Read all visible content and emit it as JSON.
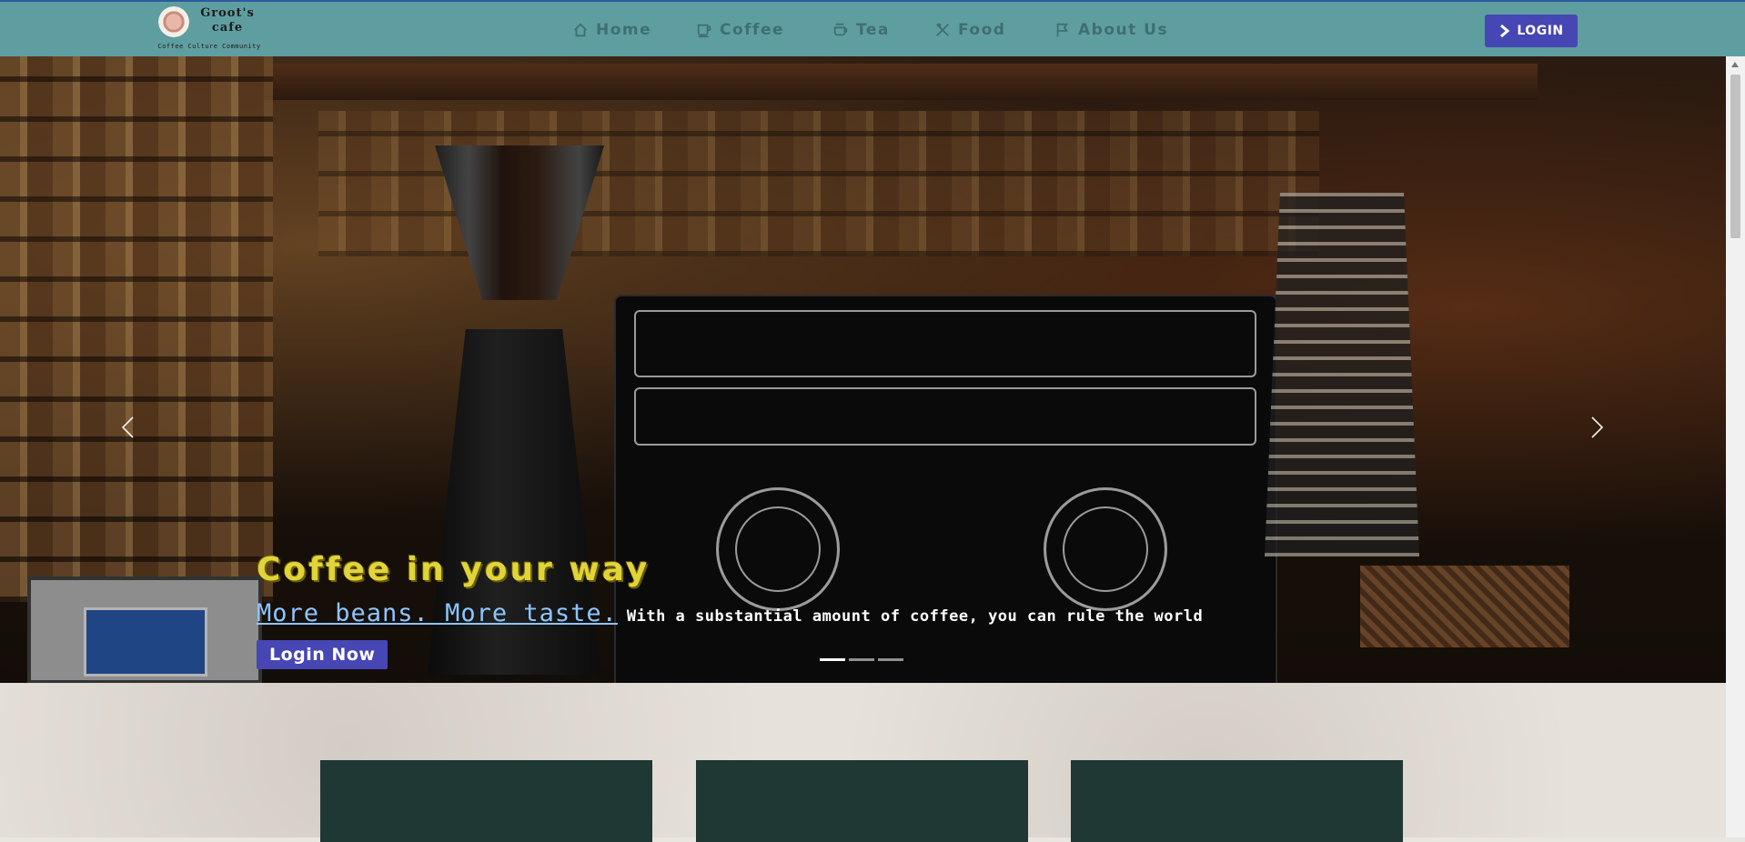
{
  "brand": {
    "name_line1": "Groot's",
    "name_line2": "cafe",
    "tagline": "Coffee  Culture  Community",
    "logo_icon": "coffee-cup-logo-icon"
  },
  "nav": {
    "items": [
      {
        "label": "Home",
        "icon": "home-icon"
      },
      {
        "label": "Coffee",
        "icon": "coffee-cup-icon"
      },
      {
        "label": "Tea",
        "icon": "tea-cup-icon"
      },
      {
        "label": "Food",
        "icon": "utensils-icon"
      },
      {
        "label": "About Us",
        "icon": "flag-icon"
      }
    ],
    "login_label": "LOGIN"
  },
  "hero": {
    "headline": "Coffee in your way",
    "subheadline_link": "More beans. More taste.",
    "subheadline_text": "With a substantial amount of coffee, you can rule the world",
    "cta_label": "Login Now",
    "slide_count": 3,
    "active_slide": 1
  },
  "colors": {
    "navbar_bg": "#5f9ea0",
    "nav_text": "#3f6f72",
    "accent_button": "#4646b4",
    "headline": "#e0d43a",
    "link": "#8ec5ff",
    "card_bg": "#1f3833"
  }
}
